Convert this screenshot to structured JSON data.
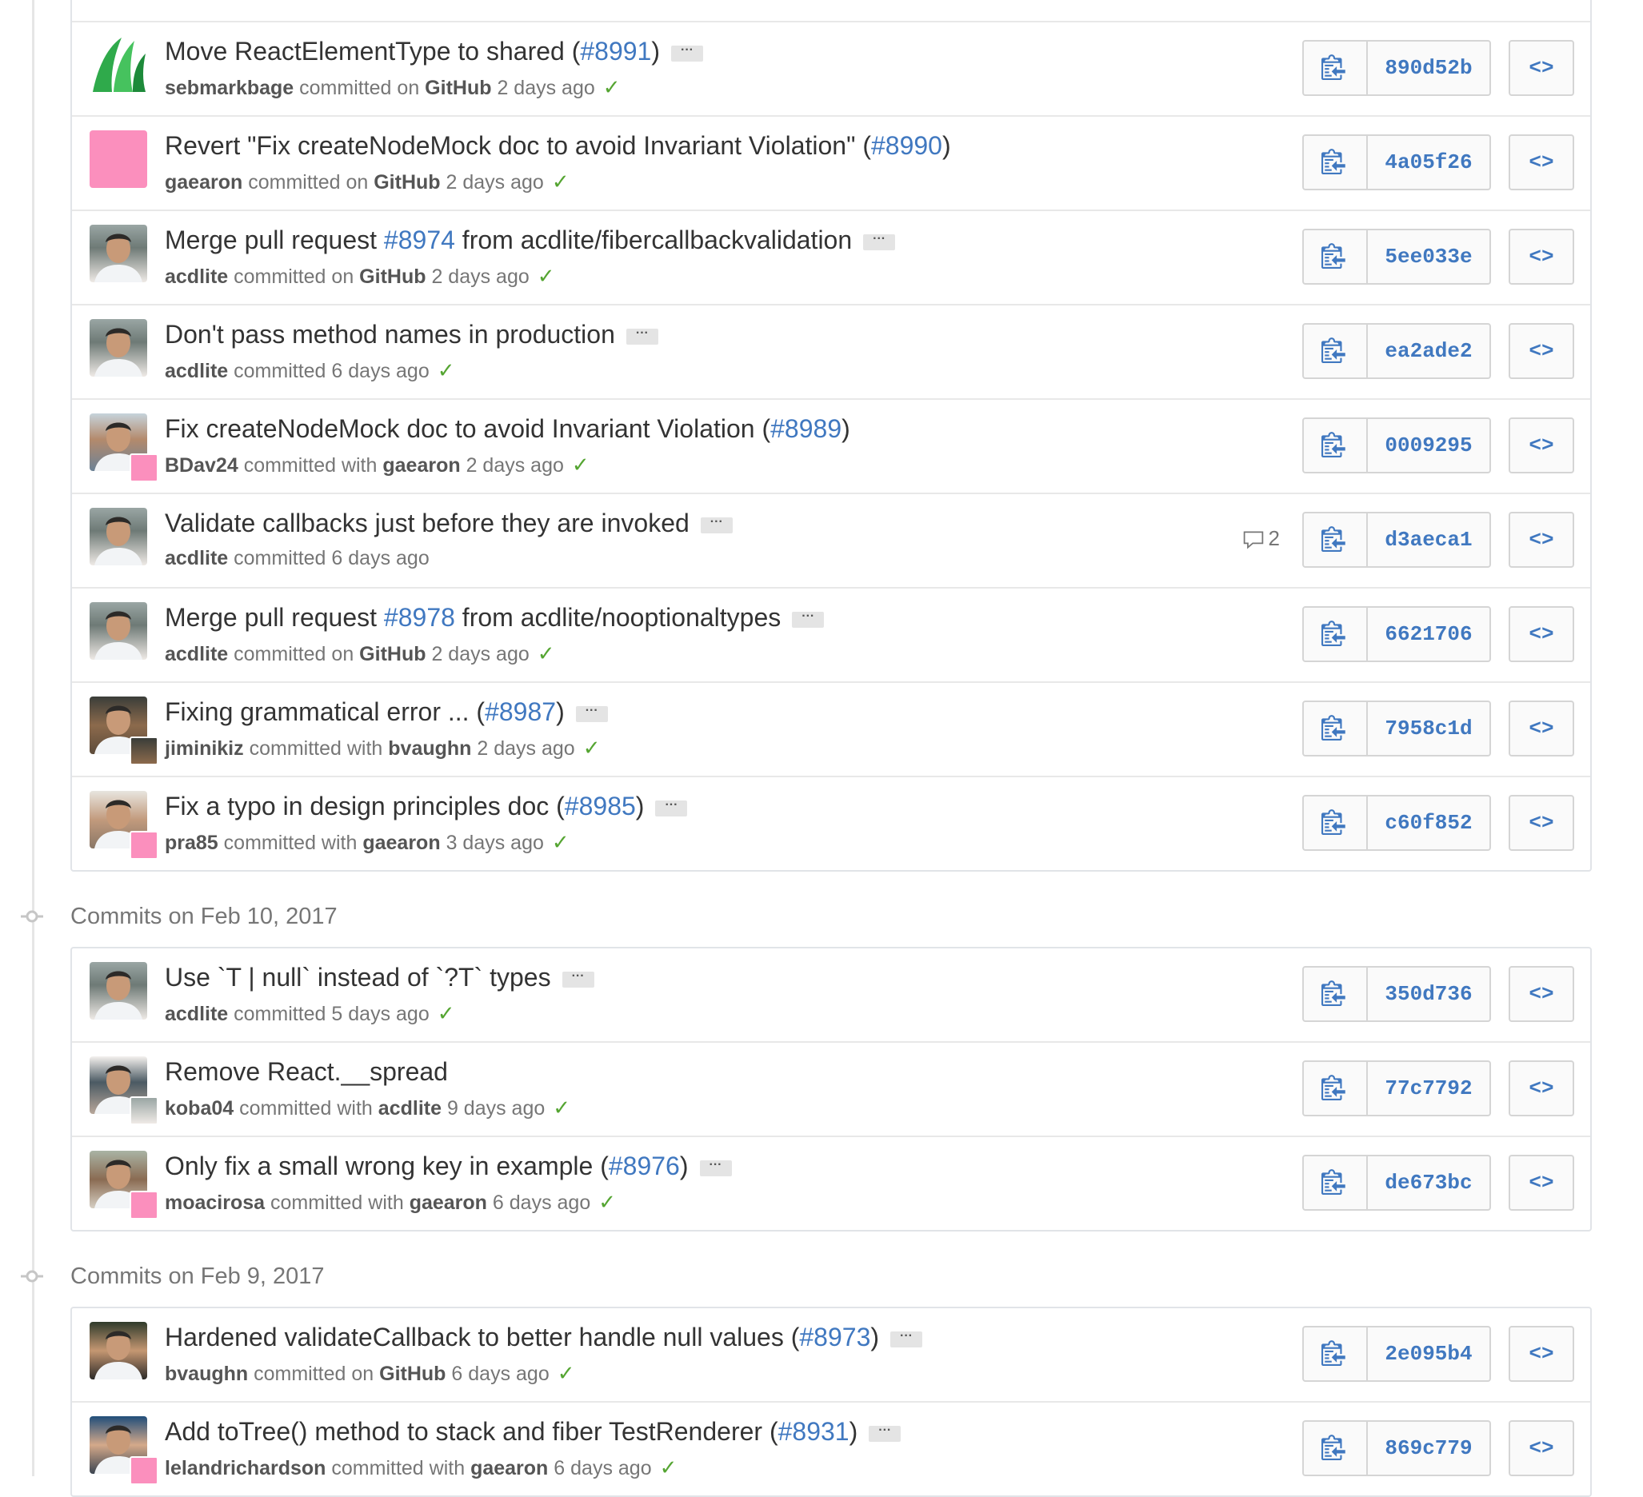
{
  "groups": [
    {
      "header": "",
      "partial_top": true,
      "commits": [
        {
          "message": "Move ReactElementType to shared (",
          "pr": "#8991",
          "suffix": ")",
          "dots": true,
          "author": "sebmarkbage",
          "verb": "committed on",
          "committer": "GitHub",
          "time": "2 days ago",
          "check": true,
          "comments": "",
          "sha": "890d52b",
          "avatar": "leaf"
        },
        {
          "message": "Revert \"Fix createNodeMock doc to avoid Invariant Violation\" (",
          "pr": "#8990",
          "suffix": ")",
          "dots": false,
          "author": "gaearon",
          "verb": "committed on",
          "committer": "GitHub",
          "time": "2 days ago",
          "check": true,
          "comments": "",
          "sha": "4a05f26",
          "avatar": "pink"
        },
        {
          "message": "Merge pull request ",
          "pr": "#8974",
          "suffix": " from acdlite/fibercallbackvalidation",
          "dots": true,
          "author": "acdlite",
          "verb": "committed on",
          "committer": "GitHub",
          "time": "2 days ago",
          "check": true,
          "comments": "",
          "sha": "5ee033e",
          "avatar": "photo"
        },
        {
          "message": "Don't pass method names in production",
          "pr": "",
          "suffix": "",
          "dots": true,
          "author": "acdlite",
          "verb": "committed",
          "committer": "",
          "time": "6 days ago",
          "check": true,
          "comments": "",
          "sha": "ea2ade2",
          "avatar": "photo"
        },
        {
          "message": "Fix createNodeMock doc to avoid Invariant Violation (",
          "pr": "#8989",
          "suffix": ")",
          "dots": false,
          "author": "BDav24",
          "verb": "committed with",
          "committer": "gaearon",
          "time": "2 days ago",
          "check": true,
          "comments": "",
          "sha": "0009295",
          "avatar": "photo2",
          "sub": "pink"
        },
        {
          "message": "Validate callbacks just before they are invoked",
          "pr": "",
          "suffix": "",
          "dots": true,
          "author": "acdlite",
          "verb": "committed",
          "committer": "",
          "time": "6 days ago",
          "check": false,
          "comments": "2",
          "sha": "d3aeca1",
          "avatar": "photo"
        },
        {
          "message": "Merge pull request ",
          "pr": "#8978",
          "suffix": " from acdlite/nooptionaltypes",
          "dots": true,
          "author": "acdlite",
          "verb": "committed on",
          "committer": "GitHub",
          "time": "2 days ago",
          "check": true,
          "comments": "",
          "sha": "6621706",
          "avatar": "photo"
        },
        {
          "message": "Fixing grammatical error ... (",
          "pr": "#8987",
          "suffix": ")",
          "dots": true,
          "author": "jiminikiz",
          "verb": "committed with",
          "committer": "bvaughn",
          "time": "2 days ago",
          "check": true,
          "comments": "",
          "sha": "7958c1d",
          "avatar": "photo3",
          "sub": "photo3"
        },
        {
          "message": "Fix a typo in design principles doc (",
          "pr": "#8985",
          "suffix": ")",
          "dots": true,
          "author": "pra85",
          "verb": "committed with",
          "committer": "gaearon",
          "time": "3 days ago",
          "check": true,
          "comments": "",
          "sha": "c60f852",
          "avatar": "photo4",
          "sub": "pink"
        }
      ]
    },
    {
      "header": "Commits on Feb 10, 2017",
      "partial_top": false,
      "commits": [
        {
          "message": "Use `T | null` instead of `?T` types",
          "pr": "",
          "suffix": "",
          "dots": true,
          "author": "acdlite",
          "verb": "committed",
          "committer": "",
          "time": "5 days ago",
          "check": true,
          "comments": "",
          "sha": "350d736",
          "avatar": "photo"
        },
        {
          "message": "Remove React.__spread",
          "pr": "",
          "suffix": "",
          "dots": false,
          "author": "koba04",
          "verb": "committed with",
          "committer": "acdlite",
          "time": "9 days ago",
          "check": true,
          "comments": "",
          "sha": "77c7792",
          "avatar": "photo5",
          "sub": "photo"
        },
        {
          "message": "Only fix a small wrong key in example (",
          "pr": "#8976",
          "suffix": ")",
          "dots": true,
          "author": "moacirosa",
          "verb": "committed with",
          "committer": "gaearon",
          "time": "6 days ago",
          "check": true,
          "comments": "",
          "sha": "de673bc",
          "avatar": "photo6",
          "sub": "pink"
        }
      ]
    },
    {
      "header": "Commits on Feb 9, 2017",
      "partial_top": false,
      "commits": [
        {
          "message": "Hardened validateCallback to better handle null values (",
          "pr": "#8973",
          "suffix": ")",
          "dots": true,
          "author": "bvaughn",
          "verb": "committed on",
          "committer": "GitHub",
          "time": "6 days ago",
          "check": true,
          "comments": "",
          "sha": "2e095b4",
          "avatar": "photo7"
        },
        {
          "message": "Add toTree() method to stack and fiber TestRenderer (",
          "pr": "#8931",
          "suffix": ")",
          "dots": true,
          "author": "lelandrichardson",
          "verb": "committed with",
          "committer": "gaearon",
          "time": "6 days ago",
          "check": true,
          "comments": "",
          "sha": "869c779",
          "avatar": "photo8",
          "sub": "pink"
        }
      ]
    }
  ],
  "icons": {
    "clipboard": "clipboard-icon",
    "browse": "code-brackets-icon",
    "check": "check-icon",
    "comment": "comment-icon",
    "more": "ellipsis-icon"
  },
  "colors": {
    "link": "#4078c0",
    "check": "#55a532",
    "pink_avatar": "#fb8fbd"
  },
  "glyphs": {
    "browse": "<>",
    "check": "✓",
    "more": "···"
  }
}
